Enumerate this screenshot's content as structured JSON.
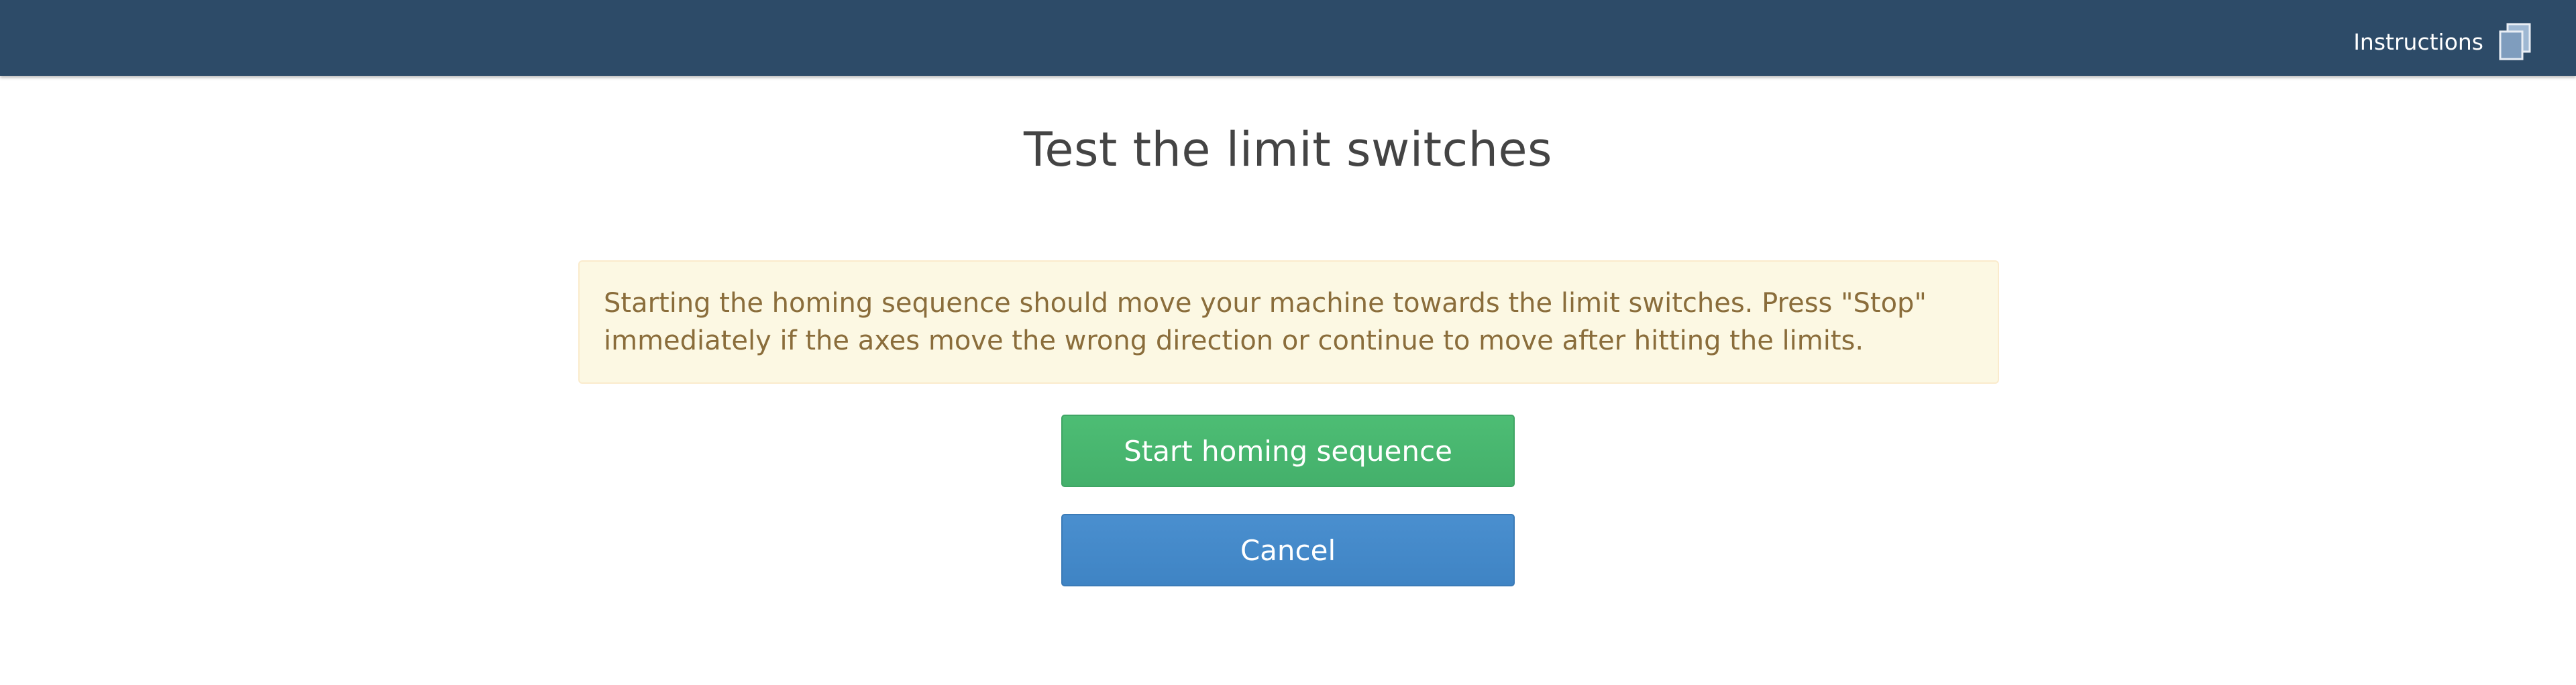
{
  "header": {
    "instructions_label": "Instructions",
    "instructions_icon": "copy-icon"
  },
  "main": {
    "title": "Test the limit switches",
    "warning_text": "Starting the homing sequence should move your machine towards the limit switches. Press \"Stop\" immediately if the axes move the wrong direction or continue to move after hitting the limits.",
    "start_button_label": "Start homing sequence",
    "cancel_button_label": "Cancel"
  },
  "colors": {
    "header_bg": "#2d4b68",
    "alert_bg": "#fcf8e3",
    "alert_text": "#8a6d3b",
    "start_button": "#48b56f",
    "cancel_button": "#4589c9"
  }
}
